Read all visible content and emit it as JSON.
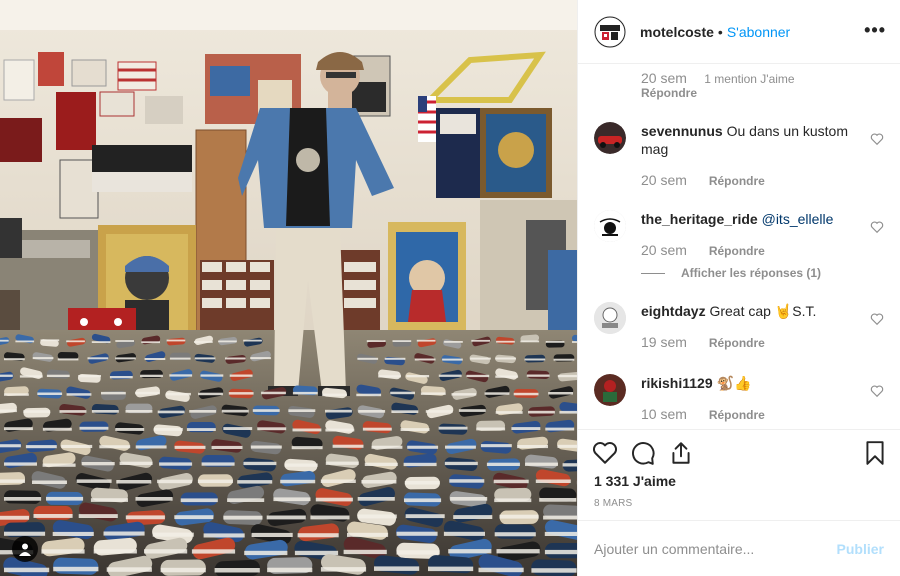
{
  "post": {
    "username": "motelcoste",
    "separator": "•",
    "follow_label": "S'abonner",
    "avatar_icon": "motelcoste-logo-avatar",
    "more_icon": "more-options-icon",
    "more_label": "•••"
  },
  "photo": {
    "alt_icon": "user-tag-icon",
    "accent_colors": [
      "#2d5fa3",
      "#c64a2c",
      "#e8e0d0"
    ]
  },
  "comment_fragment": {
    "time": "20 sem",
    "likes": "1 mention J'aime",
    "reply": "Répondre"
  },
  "comments": [
    {
      "username": "sevennunus",
      "text": "Ou dans un kustom mag",
      "time": "20 sem",
      "reply": "Répondre",
      "avatar": "red-car-avatar"
    },
    {
      "username": "the_heritage_ride",
      "text": "",
      "mention": "@its_ellelle",
      "time": "20 sem",
      "reply": "Répondre",
      "view_replies": "Afficher les réponses (1)",
      "avatar": "heritage-ride-logo-avatar"
    },
    {
      "username": "eightdayz",
      "text": "Great cap 🤘S.T.",
      "time": "19 sem",
      "reply": "Répondre",
      "avatar": "eightdayz-logo-avatar"
    },
    {
      "username": "rikishi1129",
      "text": "🐒👍",
      "time": "10 sem",
      "reply": "Répondre",
      "avatar": "rikishi-avatar"
    }
  ],
  "actions": {
    "like_icon": "heart-icon",
    "comment_icon": "comment-icon",
    "share_icon": "share-icon",
    "save_icon": "bookmark-icon"
  },
  "likes_count": "1 331 J'aime",
  "date": "8 MARS",
  "add_comment": {
    "placeholder": "Ajouter un commentaire...",
    "publish_label": "Publier"
  }
}
